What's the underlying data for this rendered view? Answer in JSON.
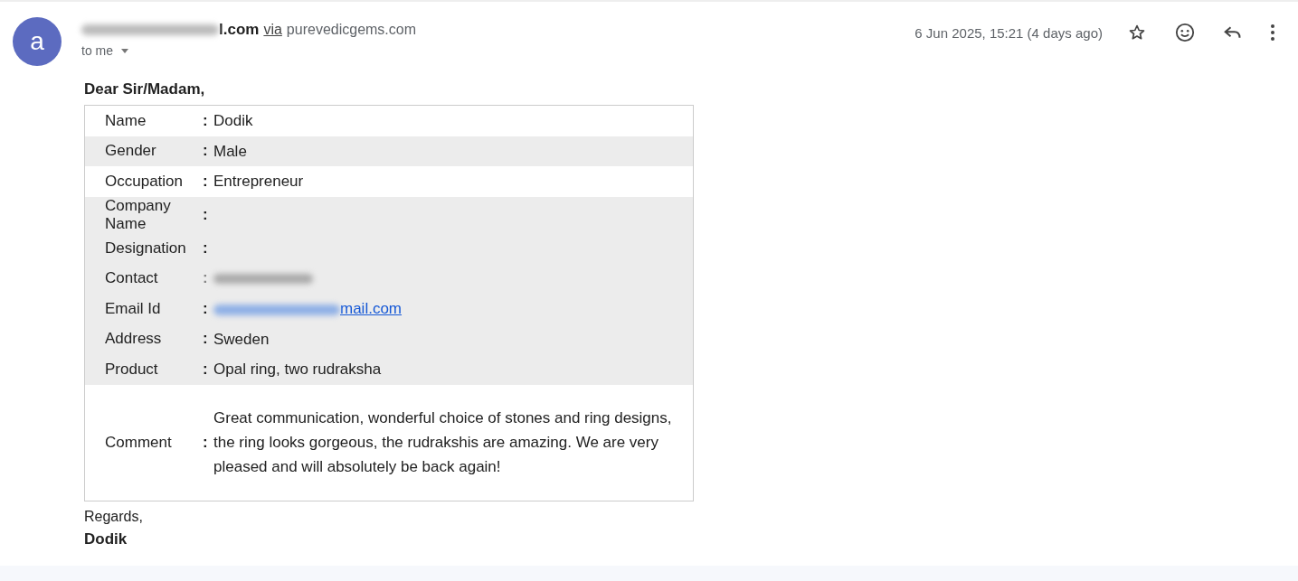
{
  "sender": {
    "avatar": "a",
    "address_visible": "l.com",
    "via_label": "via",
    "via_domain": "purevedicgems.com",
    "recipient": "to me"
  },
  "date": "6 Jun 2025, 15:21 (4 days ago)",
  "greeting": "Dear Sir/Madam,",
  "rows": [
    {
      "label": "Name",
      "separator": ":",
      "value": "Dodik",
      "shaded": false,
      "kind": "text"
    },
    {
      "label": "Gender",
      "separator": ":",
      "value": "Male",
      "shaded": true,
      "kind": "text"
    },
    {
      "label": "Occupation",
      "separator": ":",
      "value": "Entrepreneur",
      "shaded": false,
      "kind": "text"
    },
    {
      "label": "Company Name",
      "separator": ":",
      "value": "",
      "shaded": true,
      "kind": "text"
    },
    {
      "label": "Designation",
      "separator": ":",
      "value": "",
      "shaded": true,
      "kind": "text"
    },
    {
      "label": "Contact",
      "separator": ":",
      "value": "",
      "shaded": true,
      "kind": "redacted"
    },
    {
      "label": "Email Id",
      "separator": ":",
      "value": "mail.com",
      "shaded": true,
      "kind": "link"
    },
    {
      "label": "Address",
      "separator": ":",
      "value": "Sweden",
      "shaded": true,
      "kind": "text"
    },
    {
      "label": "Product",
      "separator": ":",
      "value": "Opal ring, two rudraksha",
      "shaded": true,
      "kind": "text"
    },
    {
      "label": "Comment",
      "separator": ":",
      "value": "Great communication, wonderful choice of stones and ring designs, the ring looks gorgeous, the rudrakshis are amazing. We are very pleased and will absolutely be back again!",
      "shaded": false,
      "kind": "text"
    }
  ],
  "closing": "Regards,",
  "signature": "Dodik"
}
